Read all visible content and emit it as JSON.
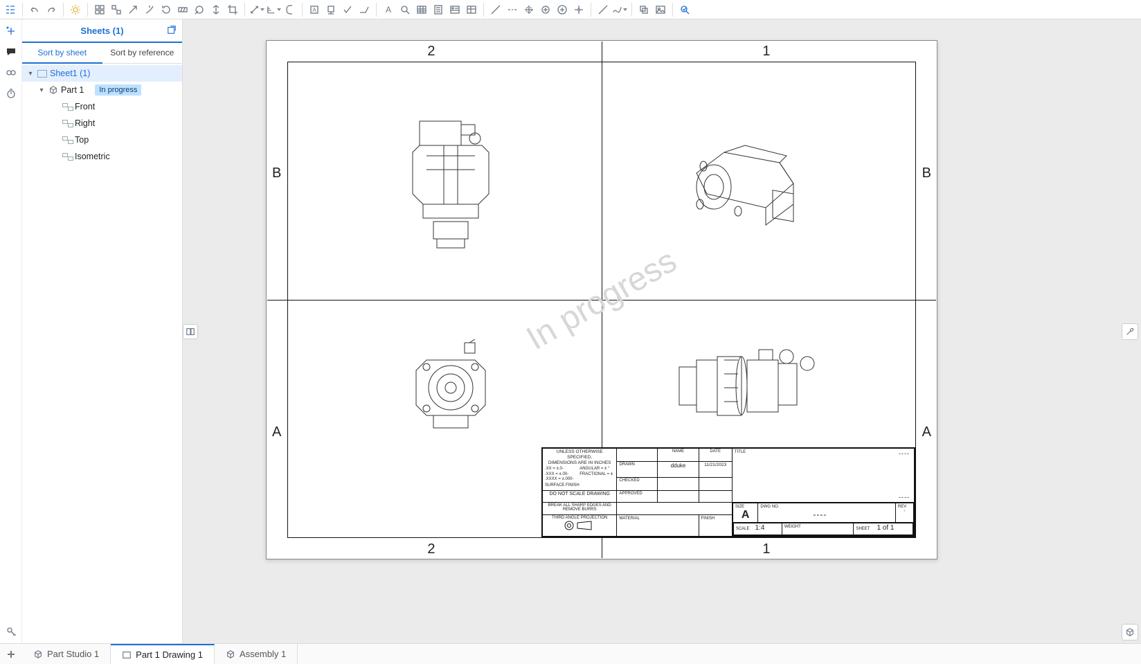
{
  "panel": {
    "title": "Sheets (1)",
    "sort_by_sheet": "Sort by sheet",
    "sort_by_reference": "Sort by reference"
  },
  "tree": {
    "sheet": "Sheet1 (1)",
    "part": "Part 1",
    "badge": "In progress",
    "views": [
      "Front",
      "Right",
      "Top",
      "Isometric"
    ]
  },
  "zones": {
    "top": [
      "2",
      "1"
    ],
    "bottom": [
      "2",
      "1"
    ],
    "left": [
      "B",
      "A"
    ],
    "right": [
      "B",
      "A"
    ]
  },
  "watermark": "In progress",
  "titleblock": {
    "unless": "UNLESS OTHERWISE SPECIFIED,\nDIMENSIONS ARE IN INCHES",
    "tol1": ".XX = ±.0-",
    "tol2": ".XXX = ±.00-",
    "tol3": ".XXXX = ±.000-",
    "ang": "ANGULAR = ± °",
    "frac": "FRACTIONAL = ±",
    "surf": "SURFACE FINISH",
    "noscale": "DO NOT SCALE DRAWING",
    "break": "BREAK ALL SHARP EDGES AND\nREMOVE BURRS",
    "proj": "THIRD ANGLE PROJECTION",
    "name_h": "NAME",
    "date_h": "DATE",
    "drawn": "DRAWN",
    "drawn_name": "dduke",
    "drawn_date": "11/21/2023",
    "checked": "CHECKED",
    "approved": "APPROVED",
    "material": "MATERIAL",
    "finish": "FINISH",
    "title": "TITLE",
    "size": "SIZE",
    "size_v": "A",
    "dwg": "DWG NO.",
    "rev": "REV",
    "scale": "SCALE",
    "scale_v": "1:4",
    "weight": "WEIGHT",
    "sheet": "SHEET",
    "sheet_v": "1 of 1",
    "dash": "----"
  },
  "tabs": {
    "t1": "Part Studio 1",
    "t2": "Part 1 Drawing 1",
    "t3": "Assembly 1"
  }
}
